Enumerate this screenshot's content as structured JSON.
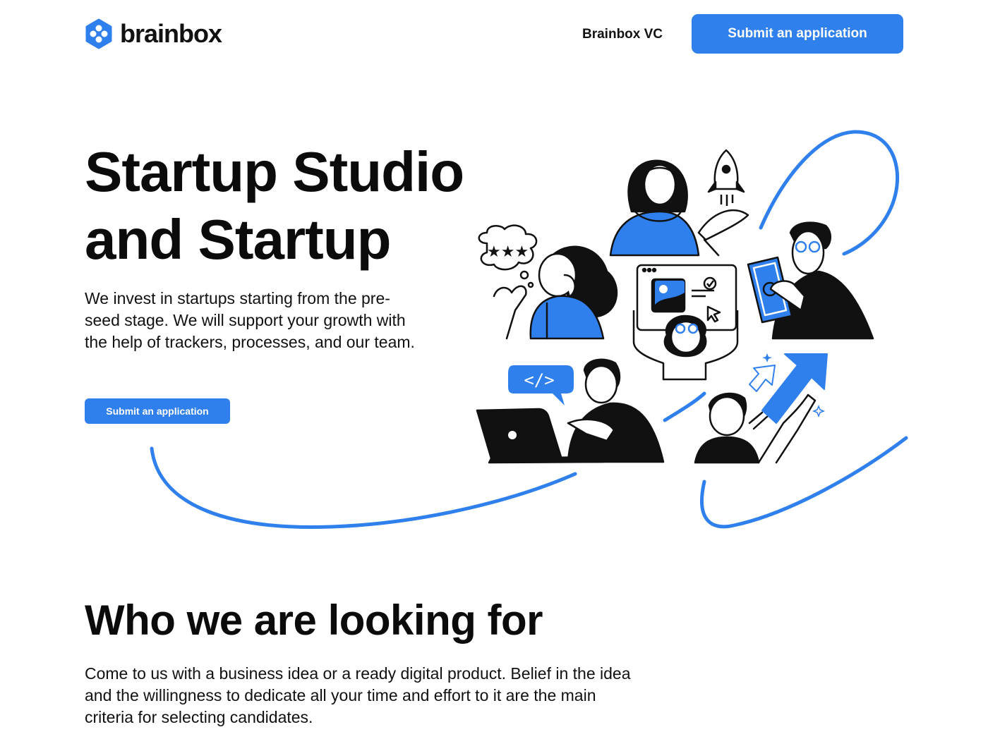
{
  "header": {
    "logo_text": "brainbox",
    "nav_link": "Brainbox VC",
    "cta_label": "Submit an application"
  },
  "hero": {
    "title_line1": "Startup Studio",
    "title_line2": "and Startup",
    "description": "We invest in startups starting from the pre-seed stage. We will support your growth with the help of trackers, processes, and our team.",
    "cta_label": "Submit an application",
    "code_bubble": "</>"
  },
  "section": {
    "title": "Who we are looking for",
    "description": "Come to us with a business idea or a ready digital product. Belief in the idea and the willingness to dedicate all your time and effort to it are the main criteria for selecting candidates."
  },
  "colors": {
    "accent": "#2f80ed",
    "text": "#0b0b0b",
    "background": "#ffffff"
  },
  "icons": [
    "brainbox-logo-icon",
    "rocket-icon",
    "image-icon",
    "check-icon",
    "cursor-icon",
    "star-icon",
    "sparkle-icon",
    "arrow-up-icon",
    "laptop-icon",
    "code-icon"
  ]
}
